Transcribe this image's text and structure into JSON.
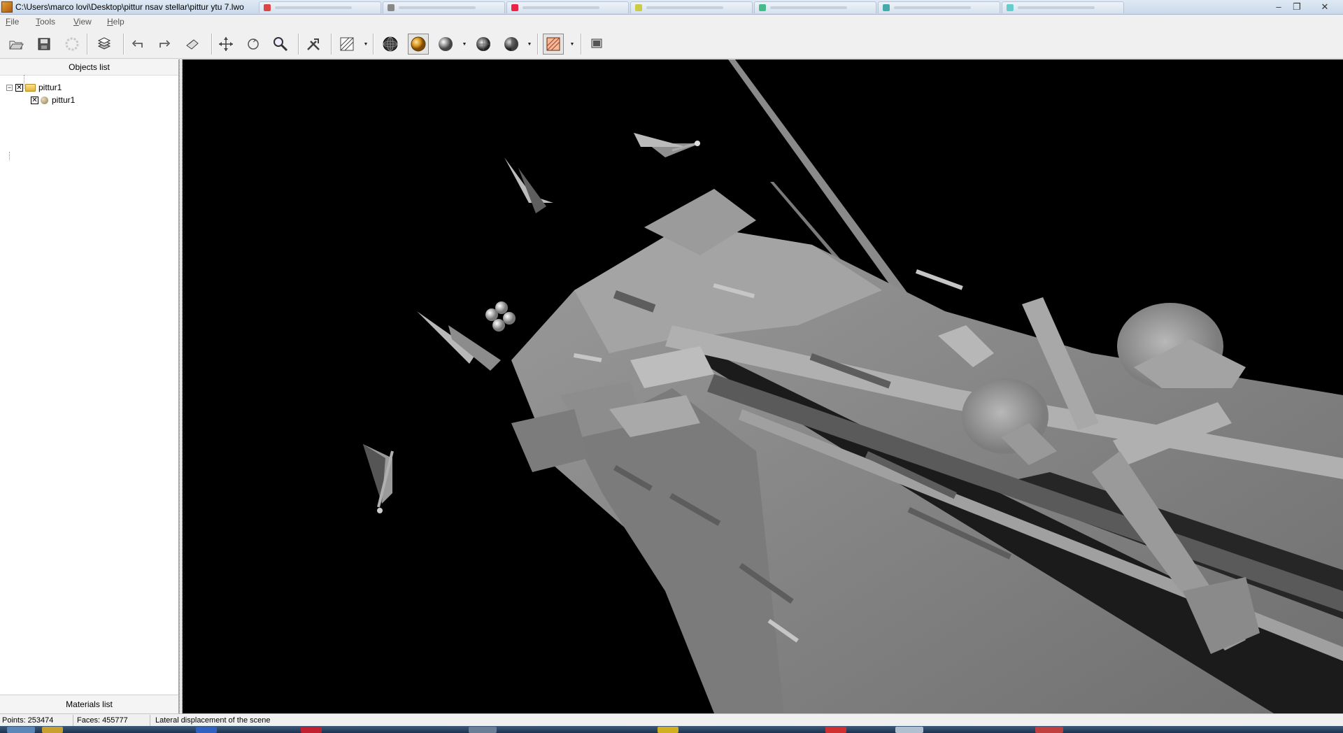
{
  "window": {
    "title": "C:\\Users\\marco lovi\\Desktop\\pittur nsav stellar\\pittur ytu 7.lwo",
    "controls": {
      "minimize": "–",
      "maximize": "❐",
      "close": "✕"
    }
  },
  "menu": {
    "items": [
      {
        "label": "File",
        "key": "F",
        "rest": "ile"
      },
      {
        "label": "Tools",
        "key": "T",
        "rest": "ools"
      },
      {
        "label": "View",
        "key": "V",
        "rest": "iew"
      },
      {
        "label": "Help",
        "key": "H",
        "rest": "elp"
      }
    ]
  },
  "toolbar": {
    "buttons": [
      {
        "name": "open-icon"
      },
      {
        "name": "save-icon"
      },
      {
        "name": "reload-icon"
      },
      {
        "name": "layers-icon"
      },
      {
        "name": "undo-icon"
      },
      {
        "name": "redo-icon"
      },
      {
        "name": "hand-icon"
      },
      {
        "name": "move-icon"
      },
      {
        "name": "rotate-icon"
      },
      {
        "name": "zoom-icon"
      },
      {
        "name": "tools-icon"
      },
      {
        "name": "grid-icon"
      },
      {
        "name": "wireframe-sphere-icon"
      },
      {
        "name": "shaded-sphere-icon",
        "pressed": true,
        "color": "#d9951e"
      },
      {
        "name": "smooth-sphere-icon"
      },
      {
        "name": "flat-sphere-icon"
      },
      {
        "name": "half-sphere-icon"
      },
      {
        "name": "texture-icon",
        "pressed": true
      },
      {
        "name": "screenshot-icon"
      }
    ]
  },
  "objects_panel": {
    "header": "Objects list",
    "tree": {
      "root": {
        "label": "pittur1",
        "expanded": true,
        "checked": true,
        "icon": "folder-icon"
      },
      "children": [
        {
          "label": "pittur1",
          "checked": true,
          "icon": "material-ball-icon"
        }
      ]
    },
    "materials_header": "Materials list"
  },
  "status": {
    "points": "Points: 253474",
    "faces": "Faces: 455777",
    "message": "Lateral displacement of the scene"
  },
  "colors": {
    "viewport_bg": "#000000",
    "model_fill": "#8f8f8f",
    "accent_shaded": "#d9951e"
  }
}
